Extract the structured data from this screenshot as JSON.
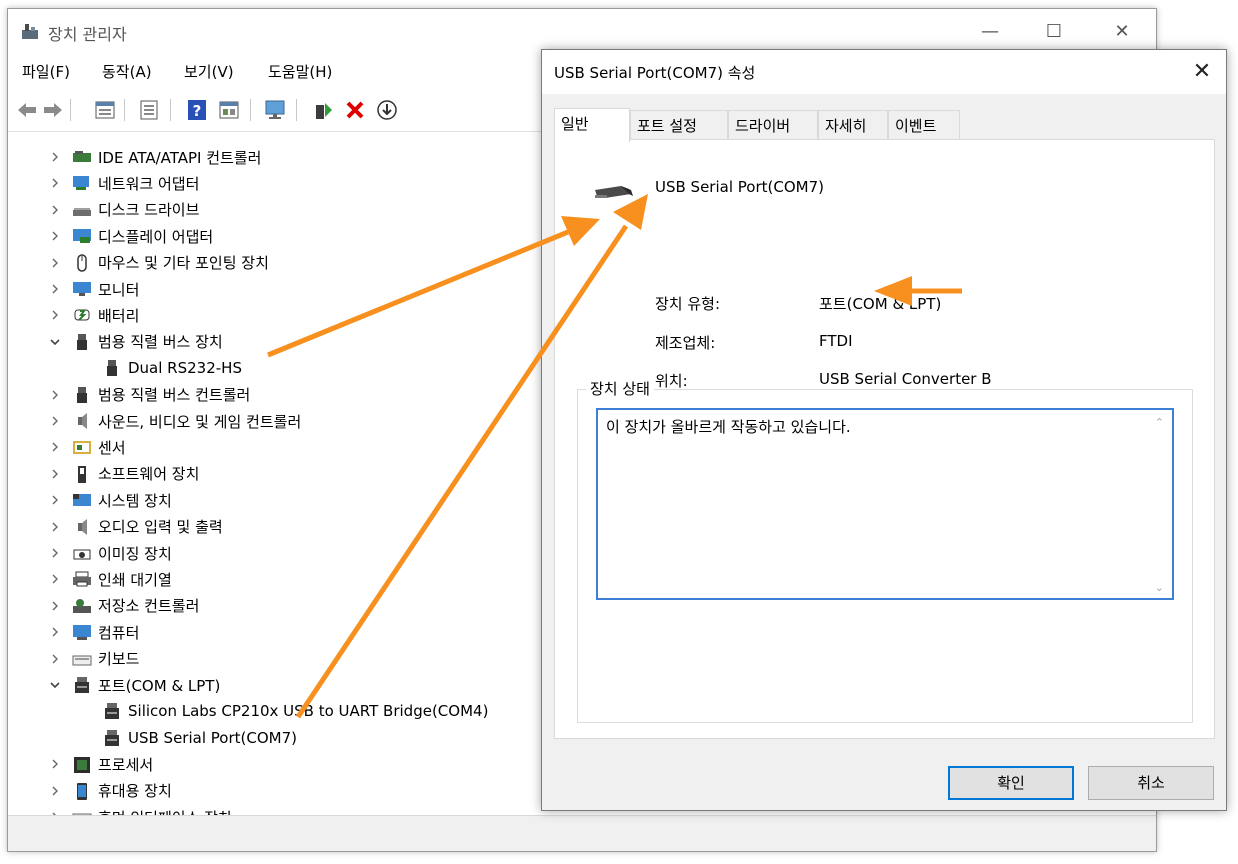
{
  "device_manager": {
    "title": "장치 관리자",
    "window_controls": {
      "minimize": "—",
      "maximize": "☐",
      "close": "✕"
    },
    "menu": [
      "파일(F)",
      "동작(A)",
      "보기(V)",
      "도움말(H)"
    ],
    "toolbar_icons": [
      "back-arrow-icon",
      "forward-arrow-icon",
      "properties-icon",
      "view-icon",
      "help-icon",
      "view-details-icon",
      "monitor-scan-icon",
      "update-driver-icon",
      "uninstall-icon",
      "download-icon"
    ],
    "tree": [
      {
        "label": "IDE ATA/ATAPI 컨트롤러",
        "expanded": false,
        "level": 0,
        "icon": "ide-controller-icon"
      },
      {
        "label": "네트워크 어댑터",
        "expanded": false,
        "level": 0,
        "icon": "network-adapter-icon"
      },
      {
        "label": "디스크 드라이브",
        "expanded": false,
        "level": 0,
        "icon": "disk-drive-icon"
      },
      {
        "label": "디스플레이 어댑터",
        "expanded": false,
        "level": 0,
        "icon": "display-adapter-icon"
      },
      {
        "label": "마우스 및 기타 포인팅 장치",
        "expanded": false,
        "level": 0,
        "icon": "mouse-icon"
      },
      {
        "label": "모니터",
        "expanded": false,
        "level": 0,
        "icon": "monitor-icon"
      },
      {
        "label": "배터리",
        "expanded": false,
        "level": 0,
        "icon": "battery-icon"
      },
      {
        "label": "범용 직렬 버스 장치",
        "expanded": true,
        "level": 0,
        "icon": "usb-icon"
      },
      {
        "label": "Dual RS232-HS",
        "level": 1,
        "icon": "usb-icon"
      },
      {
        "label": "범용 직렬 버스 컨트롤러",
        "expanded": false,
        "level": 0,
        "icon": "usb-icon"
      },
      {
        "label": "사운드, 비디오 및 게임 컨트롤러",
        "expanded": false,
        "level": 0,
        "icon": "speaker-icon"
      },
      {
        "label": "센서",
        "expanded": false,
        "level": 0,
        "icon": "sensor-icon"
      },
      {
        "label": "소프트웨어 장치",
        "expanded": false,
        "level": 0,
        "icon": "software-device-icon"
      },
      {
        "label": "시스템 장치",
        "expanded": false,
        "level": 0,
        "icon": "system-device-icon"
      },
      {
        "label": "오디오 입력 및 출력",
        "expanded": false,
        "level": 0,
        "icon": "speaker-icon"
      },
      {
        "label": "이미징 장치",
        "expanded": false,
        "level": 0,
        "icon": "camera-icon"
      },
      {
        "label": "인쇄 대기열",
        "expanded": false,
        "level": 0,
        "icon": "printer-icon"
      },
      {
        "label": "저장소 컨트롤러",
        "expanded": false,
        "level": 0,
        "icon": "storage-controller-icon"
      },
      {
        "label": "컴퓨터",
        "expanded": false,
        "level": 0,
        "icon": "computer-icon"
      },
      {
        "label": "키보드",
        "expanded": false,
        "level": 0,
        "icon": "keyboard-icon"
      },
      {
        "label": "포트(COM & LPT)",
        "expanded": true,
        "level": 0,
        "icon": "port-icon"
      },
      {
        "label": "Silicon Labs CP210x USB to UART Bridge(COM4)",
        "level": 1,
        "icon": "port-icon"
      },
      {
        "label": "USB Serial Port(COM7)",
        "level": 1,
        "icon": "port-icon"
      },
      {
        "label": "프로세서",
        "expanded": false,
        "level": 0,
        "icon": "processor-icon"
      },
      {
        "label": "휴대용 장치",
        "expanded": false,
        "level": 0,
        "icon": "portable-device-icon"
      },
      {
        "label": "휴먼 인터페이스 장치",
        "expanded": false,
        "level": 0,
        "icon": "hid-icon"
      }
    ]
  },
  "properties_dialog": {
    "title": "USB Serial Port(COM7) 속성",
    "close_glyph": "✕",
    "tabs": [
      "일반",
      "포트 설정",
      "드라이버",
      "자세히",
      "이벤트"
    ],
    "active_tab": "일반",
    "device_name": "USB Serial Port(COM7)",
    "device_icon": "serial-port-icon",
    "properties": [
      {
        "label": "장치 유형:",
        "value": "포트(COM & LPT)"
      },
      {
        "label": "제조업체:",
        "value": "FTDI"
      },
      {
        "label": "위치:",
        "value": "USB Serial Converter B"
      }
    ],
    "status_group_label": "장치 상태",
    "status_text": "이 장치가 올바르게 작동하고 있습니다.",
    "scroll_up_glyph": "⌃",
    "scroll_down_glyph": "⌄",
    "ok_button": "확인",
    "cancel_button": "취소"
  },
  "colors": {
    "annotation_arrow": "#f7901e",
    "focus_border": "#3c7fd4",
    "default_button_border": "#0078d7"
  }
}
